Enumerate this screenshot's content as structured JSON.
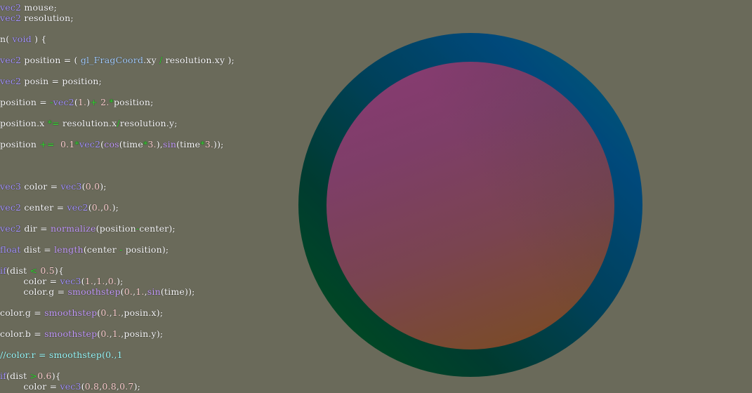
{
  "editor": {
    "colors": {
      "background": "#6a6a5a",
      "ring_blue": "#004878",
      "ring_green": "#00501c",
      "disc_magenta": "#8a3a74",
      "disc_brown": "#80461e",
      "keyword": "#a898ff",
      "operator": "#33dd33",
      "number": "#ffd2d2",
      "builtin": "#a8d0ff",
      "function": "#c8a0ff",
      "comment": "#9fffff"
    },
    "lines": [
      {
        "tokens": [
          {
            "k": "kw",
            "t": "vec2"
          },
          {
            "k": "id",
            "t": " mouse;"
          }
        ]
      },
      {
        "tokens": [
          {
            "k": "kw",
            "t": "vec2"
          },
          {
            "k": "id",
            "t": " resolution;"
          }
        ]
      },
      {
        "tokens": [
          {
            "k": "id",
            "t": "n( "
          },
          {
            "k": "kw",
            "t": "void"
          },
          {
            "k": "id",
            "t": " ) {"
          }
        ]
      },
      {
        "tokens": [
          {
            "k": "kw",
            "t": "vec2"
          },
          {
            "k": "id",
            "t": " position = ( "
          },
          {
            "k": "bi",
            "t": "gl_FragCoord"
          },
          {
            "k": "id",
            "t": ".xy "
          },
          {
            "k": "op",
            "t": "/"
          },
          {
            "k": "id",
            "t": " resolution.xy );"
          }
        ]
      },
      {
        "tokens": [
          {
            "k": "kw",
            "t": "vec2"
          },
          {
            "k": "id",
            "t": " posin = position;"
          }
        ]
      },
      {
        "tokens": [
          {
            "k": "id",
            "t": "position = "
          },
          {
            "k": "op",
            "t": "-"
          },
          {
            "k": "kw",
            "t": "vec2"
          },
          {
            "k": "id",
            "t": "("
          },
          {
            "k": "num",
            "t": "1."
          },
          {
            "k": "id",
            "t": ")"
          },
          {
            "k": "op",
            "t": "+"
          },
          {
            "k": "num",
            "t": " 2."
          },
          {
            "k": "op",
            "t": "*"
          },
          {
            "k": "id",
            "t": "position;"
          }
        ]
      },
      {
        "tokens": [
          {
            "k": "id",
            "t": "position.x "
          },
          {
            "k": "op",
            "t": "*="
          },
          {
            "k": "id",
            "t": " resolution.x"
          },
          {
            "k": "op",
            "t": "/"
          },
          {
            "k": "id",
            "t": "resolution.y;"
          }
        ]
      },
      {
        "tokens": [
          {
            "k": "id",
            "t": "position "
          },
          {
            "k": "op",
            "t": "+="
          },
          {
            "k": "num",
            "t": "  0.1"
          },
          {
            "k": "op",
            "t": "*"
          },
          {
            "k": "kw",
            "t": "vec2"
          },
          {
            "k": "id",
            "t": "("
          },
          {
            "k": "fn",
            "t": "cos"
          },
          {
            "k": "id",
            "t": "(time"
          },
          {
            "k": "op",
            "t": "*"
          },
          {
            "k": "num",
            "t": "3."
          },
          {
            "k": "id",
            "t": "),"
          },
          {
            "k": "fn",
            "t": "sin"
          },
          {
            "k": "id",
            "t": "(time"
          },
          {
            "k": "op",
            "t": "*"
          },
          {
            "k": "num",
            "t": "3."
          },
          {
            "k": "id",
            "t": "));"
          }
        ]
      },
      {
        "tokens": [
          {
            "k": "kw",
            "t": "vec3"
          },
          {
            "k": "id",
            "t": " color = "
          },
          {
            "k": "kw",
            "t": "vec3"
          },
          {
            "k": "id",
            "t": "("
          },
          {
            "k": "num",
            "t": "0.0"
          },
          {
            "k": "id",
            "t": ");"
          }
        ]
      },
      {
        "tokens": [
          {
            "k": "kw",
            "t": "vec2"
          },
          {
            "k": "id",
            "t": " center = "
          },
          {
            "k": "kw",
            "t": "vec2"
          },
          {
            "k": "id",
            "t": "("
          },
          {
            "k": "num",
            "t": "0."
          },
          {
            "k": "id",
            "t": ","
          },
          {
            "k": "num",
            "t": "0."
          },
          {
            "k": "id",
            "t": ");"
          }
        ]
      },
      {
        "tokens": [
          {
            "k": "kw",
            "t": "vec2"
          },
          {
            "k": "id",
            "t": " dir = "
          },
          {
            "k": "fn",
            "t": "normalize"
          },
          {
            "k": "id",
            "t": "(position"
          },
          {
            "k": "op",
            "t": "-"
          },
          {
            "k": "id",
            "t": "center);"
          }
        ]
      },
      {
        "tokens": [
          {
            "k": "kw",
            "t": "float"
          },
          {
            "k": "id",
            "t": " dist = "
          },
          {
            "k": "fn",
            "t": "length"
          },
          {
            "k": "id",
            "t": "(center "
          },
          {
            "k": "op",
            "t": "-"
          },
          {
            "k": "id",
            "t": " position);"
          }
        ]
      },
      {
        "tokens": [
          {
            "k": "kw",
            "t": "if"
          },
          {
            "k": "id",
            "t": "(dist "
          },
          {
            "k": "op",
            "t": "<"
          },
          {
            "k": "num",
            "t": " 0.5"
          },
          {
            "k": "id",
            "t": "){"
          }
        ]
      },
      {
        "tokens": [
          {
            "k": "id",
            "t": "        color = "
          },
          {
            "k": "kw",
            "t": "vec3"
          },
          {
            "k": "id",
            "t": "("
          },
          {
            "k": "num",
            "t": "1."
          },
          {
            "k": "id",
            "t": ","
          },
          {
            "k": "num",
            "t": "1."
          },
          {
            "k": "id",
            "t": ","
          },
          {
            "k": "num",
            "t": "0."
          },
          {
            "k": "id",
            "t": ");"
          }
        ]
      },
      {
        "tokens": [
          {
            "k": "id",
            "t": "        color.g = "
          },
          {
            "k": "fn",
            "t": "smoothstep"
          },
          {
            "k": "id",
            "t": "("
          },
          {
            "k": "num",
            "t": "0."
          },
          {
            "k": "id",
            "t": ","
          },
          {
            "k": "num",
            "t": "1."
          },
          {
            "k": "id",
            "t": ","
          },
          {
            "k": "fn",
            "t": "sin"
          },
          {
            "k": "id",
            "t": "(time));"
          }
        ]
      },
      {
        "tokens": [
          {
            "k": "id",
            "t": "color.g = "
          },
          {
            "k": "fn",
            "t": "smoothstep"
          },
          {
            "k": "id",
            "t": "("
          },
          {
            "k": "num",
            "t": "0."
          },
          {
            "k": "id",
            "t": ","
          },
          {
            "k": "num",
            "t": "1."
          },
          {
            "k": "id",
            "t": ",posin.x);"
          }
        ]
      },
      {
        "tokens": [
          {
            "k": "id",
            "t": "color.b = "
          },
          {
            "k": "fn",
            "t": "smoothstep"
          },
          {
            "k": "id",
            "t": "("
          },
          {
            "k": "num",
            "t": "0."
          },
          {
            "k": "id",
            "t": ","
          },
          {
            "k": "num",
            "t": "1."
          },
          {
            "k": "id",
            "t": ",posin.y);"
          }
        ]
      },
      {
        "tokens": [
          {
            "k": "cm",
            "t": "//color.r = smoothstep(0.,1"
          }
        ]
      },
      {
        "tokens": [
          {
            "k": "kw",
            "t": "if"
          },
          {
            "k": "id",
            "t": "(dist "
          },
          {
            "k": "op",
            "t": ">"
          },
          {
            "k": "num",
            "t": "0.6"
          },
          {
            "k": "id",
            "t": "){"
          }
        ]
      },
      {
        "tokens": [
          {
            "k": "id",
            "t": "        color = "
          },
          {
            "k": "kw",
            "t": "vec3"
          },
          {
            "k": "id",
            "t": "("
          },
          {
            "k": "num",
            "t": "0.8"
          },
          {
            "k": "id",
            "t": ","
          },
          {
            "k": "num",
            "t": "0.8"
          },
          {
            "k": "id",
            "t": ","
          },
          {
            "k": "num",
            "t": "0.7"
          },
          {
            "k": "id",
            "t": ");"
          }
        ]
      }
    ]
  }
}
